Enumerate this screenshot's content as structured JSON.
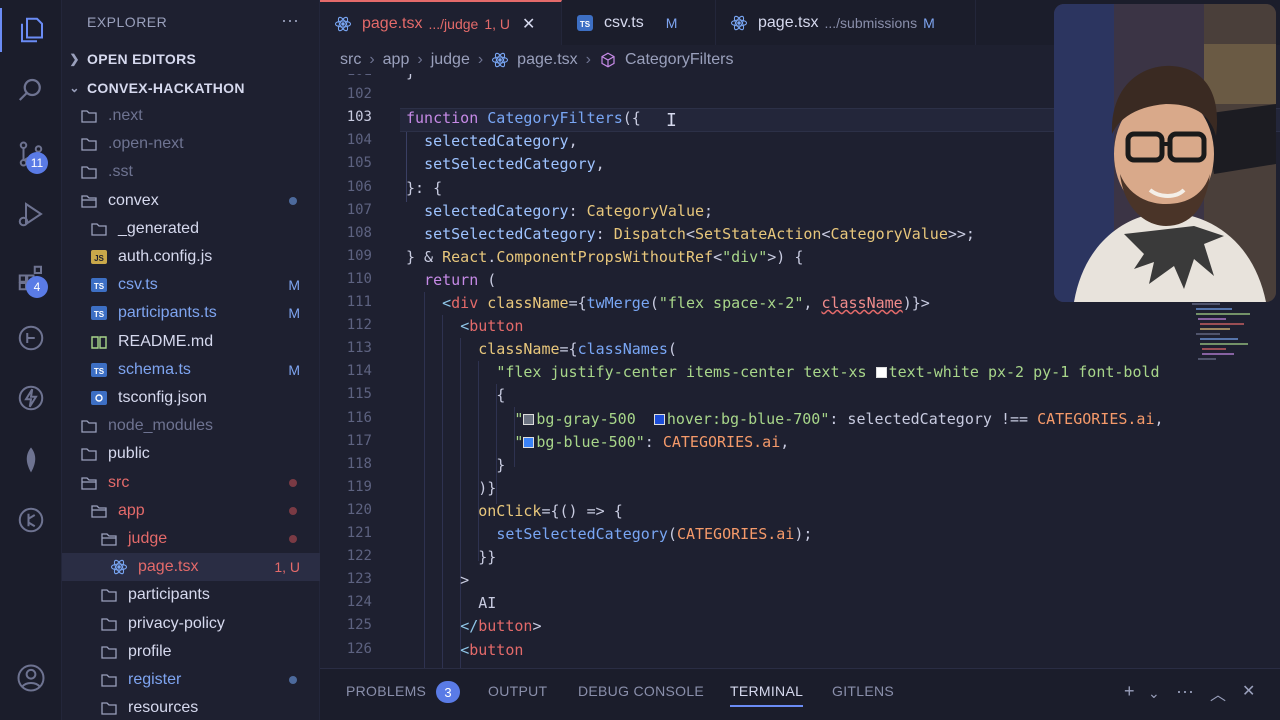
{
  "activity_bar": {
    "items": [
      {
        "name": "explorer-icon"
      },
      {
        "name": "search-icon"
      },
      {
        "name": "source-control-icon",
        "badge": "11"
      },
      {
        "name": "run-debug-icon"
      },
      {
        "name": "extensions-icon",
        "badge": "4"
      },
      {
        "name": "remote-explorer-icon"
      },
      {
        "name": "lightning-icon"
      },
      {
        "name": "leaf-icon"
      },
      {
        "name": "git-graph-icon"
      }
    ],
    "account": {
      "name": "account-icon"
    }
  },
  "sidebar": {
    "title": "EXPLORER",
    "more": "···",
    "open_editors": "OPEN EDITORS",
    "project": "CONVEX-HACKATHON",
    "tree": [
      {
        "label": ".next",
        "kind": "folder",
        "depth": 0,
        "dim": true
      },
      {
        "label": ".open-next",
        "kind": "folder",
        "depth": 0,
        "dim": true
      },
      {
        "label": ".sst",
        "kind": "folder",
        "depth": 0,
        "dim": true
      },
      {
        "label": "convex",
        "kind": "folder-open",
        "depth": 0,
        "dot": "#4d6a9c"
      },
      {
        "label": "_generated",
        "kind": "folder",
        "depth": 1
      },
      {
        "label": "auth.config.js",
        "kind": "js",
        "depth": 1
      },
      {
        "label": "csv.ts",
        "kind": "ts",
        "depth": 1,
        "status": "M"
      },
      {
        "label": "participants.ts",
        "kind": "ts",
        "depth": 1,
        "status": "M"
      },
      {
        "label": "README.md",
        "kind": "md",
        "depth": 1
      },
      {
        "label": "schema.ts",
        "kind": "ts",
        "depth": 1,
        "status": "M"
      },
      {
        "label": "tsconfig.json",
        "kind": "tsconfig",
        "depth": 1
      },
      {
        "label": "node_modules",
        "kind": "folder",
        "depth": 0,
        "dim": true
      },
      {
        "label": "public",
        "kind": "folder",
        "depth": 0
      },
      {
        "label": "src",
        "kind": "folder-open",
        "depth": 0,
        "red": true,
        "dot": "#7a3a44"
      },
      {
        "label": "app",
        "kind": "folder-open",
        "depth": 1,
        "red": true,
        "dot": "#7a3a44"
      },
      {
        "label": "judge",
        "kind": "folder-open",
        "depth": 2,
        "red": true,
        "dot": "#7a3a44"
      },
      {
        "label": "page.tsx",
        "kind": "react",
        "depth": 3,
        "red": true,
        "status": "1, U",
        "selected": true
      },
      {
        "label": "participants",
        "kind": "folder",
        "depth": 2
      },
      {
        "label": "privacy-policy",
        "kind": "folder",
        "depth": 2
      },
      {
        "label": "profile",
        "kind": "folder",
        "depth": 2
      },
      {
        "label": "register",
        "kind": "folder",
        "depth": 2,
        "blue": true,
        "dot": "#4d6a9c"
      },
      {
        "label": "resources",
        "kind": "folder",
        "depth": 2
      }
    ]
  },
  "tabs": [
    {
      "label": "page.tsx",
      "desc": ".../judge",
      "status": "1, U",
      "active": true,
      "close": "✕"
    },
    {
      "label": "csv.ts",
      "desc": "",
      "status": "M",
      "active": false
    },
    {
      "label": "page.tsx",
      "desc": ".../submissions",
      "status": "M",
      "active": false
    }
  ],
  "breadcrumbs": [
    "src",
    "app",
    "judge",
    "page.tsx",
    "CategoryFilters"
  ],
  "editor": {
    "line_numbers": [
      "101",
      "102",
      "103",
      "104",
      "105",
      "106",
      "107",
      "108",
      "109",
      "110",
      "111",
      "112",
      "113",
      "114",
      "115",
      "116",
      "117",
      "118",
      "119",
      "120",
      "121",
      "122",
      "123",
      "124",
      "125",
      "126"
    ],
    "lines": [
      "}",
      "",
      "function CategoryFilters({",
      "  selectedCategory,",
      "  setSelectedCategory,",
      "}: {",
      "  selectedCategory: CategoryValue;",
      "  setSelectedCategory: Dispatch<SetStateAction<CategoryValue>>;",
      "} & React.ComponentPropsWithoutRef<\"div\">) {",
      "  return (",
      "    <div className={twMerge(\"flex space-x-2\", className)}>",
      "      <button",
      "        className={classNames(",
      "          \"flex justify-center items-center text-xs  text-white px-2 py-1 font-bold",
      "          {",
      "            \" bg-gray-500  hover:bg-blue-700\": selectedCategory !== CATEGORIES.ai,",
      "            \" bg-blue-500\": CATEGORIES.ai,",
      "          }",
      "        )}",
      "        onClick={() => {",
      "          setSelectedCategory(CATEGORIES.ai);",
      "        }}",
      "      >",
      "        AI",
      "      </button>",
      "      <button"
    ]
  },
  "panel": {
    "tabs": [
      "PROBLEMS",
      "OUTPUT",
      "DEBUG CONSOLE",
      "TERMINAL",
      "GITLENS"
    ],
    "problems_count": "3",
    "active": "TERMINAL",
    "icons": [
      "plus-icon",
      "chevron-down-icon",
      "more-icon",
      "chevron-up-icon",
      "close-icon"
    ]
  },
  "colors": {
    "accent": "#6b8cf5",
    "error": "#e46a6a",
    "background": "#1e2030"
  }
}
